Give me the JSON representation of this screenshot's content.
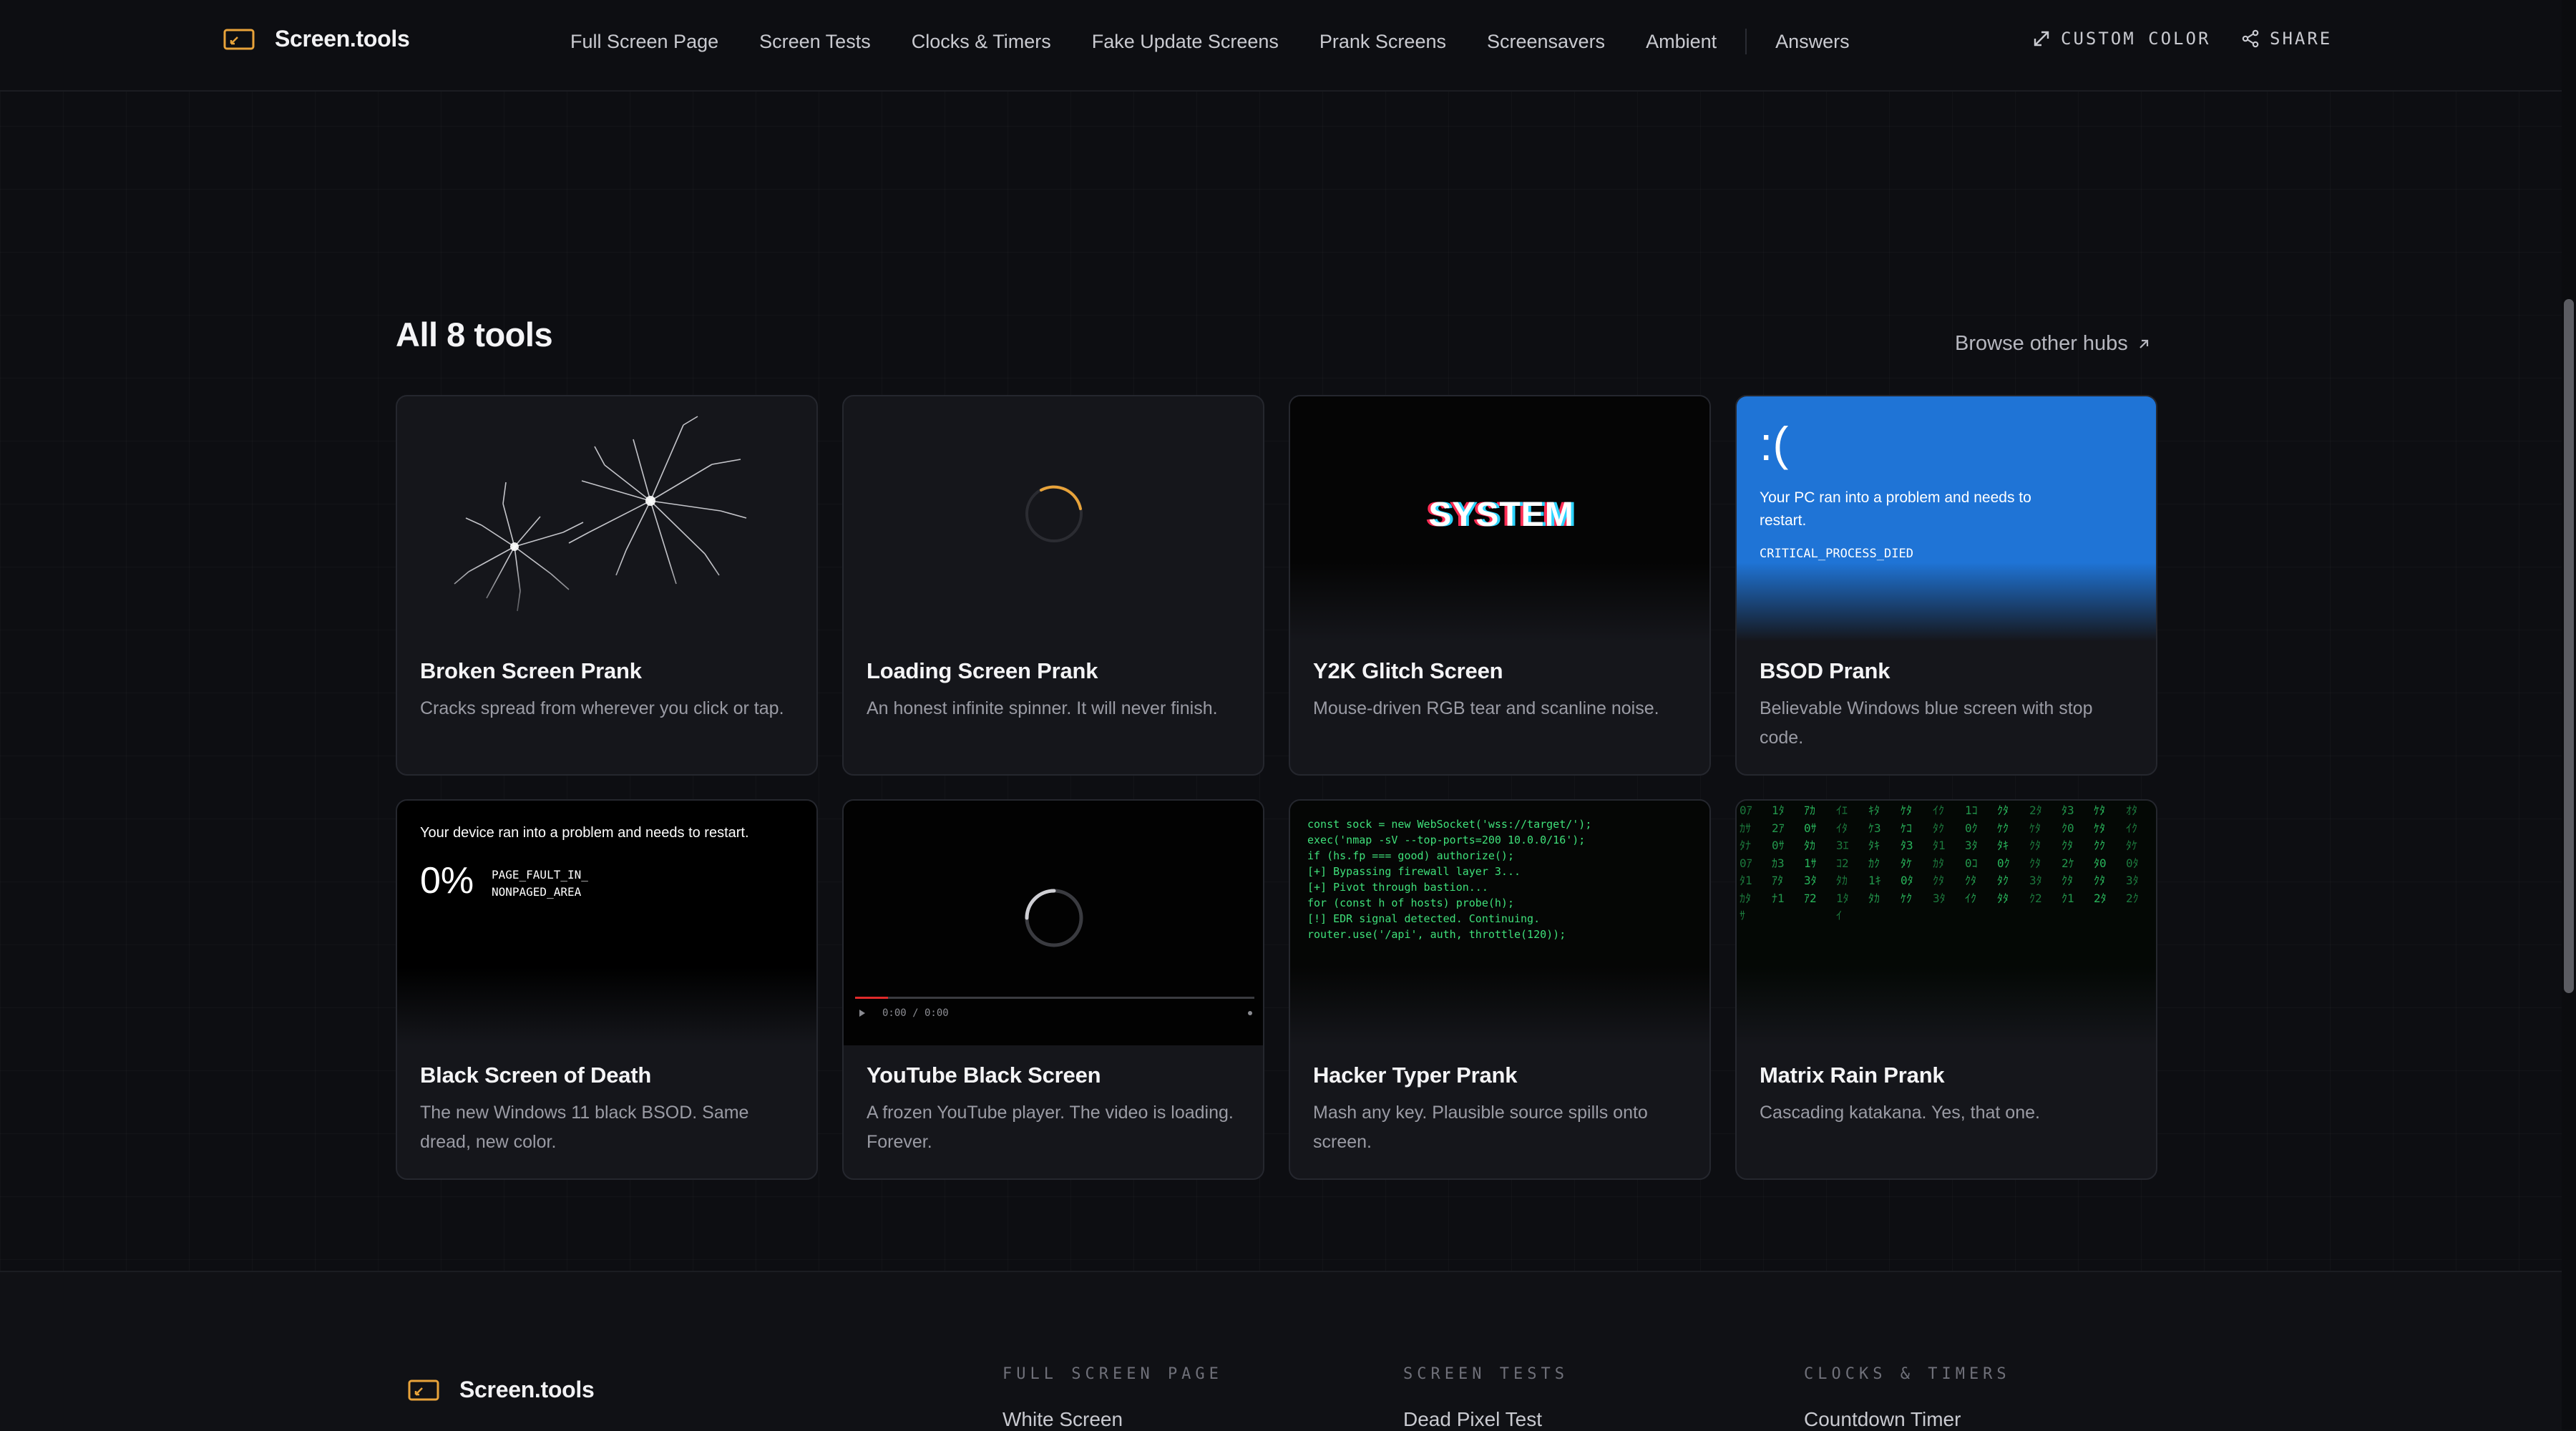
{
  "header": {
    "logo": "Screen.tools",
    "nav": [
      "Full Screen Page",
      "Screen Tests",
      "Clocks & Timers",
      "Fake Update Screens",
      "Prank Screens",
      "Screensavers",
      "Ambient",
      "Answers"
    ],
    "custom_color": "CUSTOM COLOR",
    "share": "SHARE"
  },
  "section": {
    "title": "All 8 tools",
    "browse": "Browse other hubs"
  },
  "cards": [
    {
      "title": "Broken Screen Prank",
      "desc": "Cracks spread from wherever you click or tap."
    },
    {
      "title": "Loading Screen Prank",
      "desc": "An honest infinite spinner. It will never finish."
    },
    {
      "title": "Y2K Glitch Screen",
      "desc": "Mouse-driven RGB tear and scanline noise.",
      "preview_text": "SYSTEM"
    },
    {
      "title": "BSOD Prank",
      "desc": "Believable Windows blue screen with stop code.",
      "preview": {
        "face": ":(",
        "message": "Your PC ran into a problem and needs to restart.",
        "code": "CRITICAL_PROCESS_DIED"
      }
    },
    {
      "title": "Black Screen of Death",
      "desc": "The new Windows 11 black BSOD. Same dread, new color.",
      "preview": {
        "message": "Your device ran into a problem and needs to restart.",
        "percent": "0%",
        "code_1": "PAGE_FAULT_IN_",
        "code_2": "NONPAGED_AREA"
      }
    },
    {
      "title": "YouTube Black Screen",
      "desc": "A frozen YouTube player. The video is loading. Forever.",
      "preview": {
        "time": "0:00 / 0:00"
      }
    },
    {
      "title": "Hacker Typer Prank",
      "desc": "Mash any key. Plausible source spills onto screen.",
      "preview": {
        "lines": [
          "const sock = new WebSocket('wss://target/');",
          "exec('nmap -sV --top-ports=200 10.0.0/16');",
          "if (hs.fp === good) authorize();",
          "[+] Bypassing firewall layer 3...",
          "[+] Pivot through bastion...",
          "for (const h of hosts) probe(h);",
          "[!] EDR signal detected. Continuing.",
          "router.use('/api', auth, throttle(120));"
        ]
      }
    },
    {
      "title": "Matrix Rain Prank",
      "desc": "Cascading katakana. Yes, that one.",
      "preview": {
        "columns": [
          "0ｱｶｻﾀﾅ0ｱﾀ1ｶﾀｻ",
          "1ﾀ2ｱ0ｻｶ3ｱﾀﾅ1",
          "ｱｶ0ｻﾀｶ1ｻ3ﾀｱ2",
          "ｲｴｲﾀ3ｴｺ2ﾀｶ1ﾀｲ",
          "ｷﾀｹ3ﾀｷｶｸ1ｷﾀｶ",
          "ｹﾀｹｺﾀ3ﾀｹ0ﾀｹｸ",
          "ｲｸﾀｸﾀ1ｶﾀｸﾀ3ﾀ",
          "1ｺ0ｸ3ﾀ0ｺｸﾀｲｸ",
          "ｸﾀｹｸﾀｷ0ｸﾀｸﾀﾀ",
          "2ﾀｹﾀｸﾀｸﾀ3ﾀｸ2",
          "ﾀ3ｸ0ｸﾀ2ｹｸﾀｸ1",
          "ｹﾀｹﾀｸｸﾀ0ｸﾀ2ﾀ",
          "ｵﾀｲｸﾀｹ0ﾀ3ﾀ2ｸ"
        ]
      }
    }
  ],
  "footer": {
    "logo": "Screen.tools",
    "columns": [
      {
        "head": "FULL SCREEN PAGE",
        "link": "White Screen"
      },
      {
        "head": "SCREEN TESTS",
        "link": "Dead Pixel Test"
      },
      {
        "head": "CLOCKS & TIMERS",
        "link": "Countdown Timer"
      }
    ]
  },
  "colors": {
    "accent": "#e8a33a",
    "bsod_blue": "#1f74d6",
    "matrix_green": "#2fd46a",
    "hacker_green": "#3fe07a"
  }
}
